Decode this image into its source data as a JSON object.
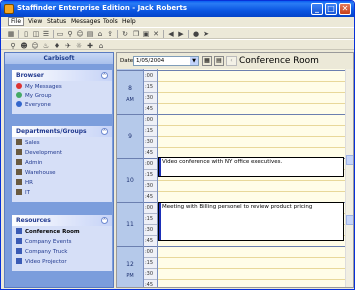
{
  "window": {
    "title": "Staffinder Enterprise Edition - Jack Roberts",
    "minimize": "_",
    "maximize": "□",
    "close": "✕"
  },
  "menu": [
    "File",
    "View",
    "Status",
    "Messages",
    "Tools",
    "Help"
  ],
  "sidebar": {
    "title": "Carbisoft",
    "browser": {
      "title": "Browser",
      "items": [
        "My Messages",
        "My Group",
        "Everyone"
      ]
    },
    "departments": {
      "title": "Departments/Groups",
      "items": [
        "Sales",
        "Development",
        "Admin",
        "Warehouse",
        "HR",
        "IT"
      ]
    },
    "resources": {
      "title": "Resources",
      "items": [
        "Conference Room",
        "Company Events",
        "Company Truck",
        "Video Projector"
      ]
    }
  },
  "main": {
    "date_label": "Date:",
    "date_value": "1/05/2004",
    "resource_title": "Conference Room",
    "hours": [
      {
        "hour": "8",
        "period": "AM"
      },
      {
        "hour": "9",
        "period": ""
      },
      {
        "hour": "10",
        "period": ""
      },
      {
        "hour": "11",
        "period": ""
      },
      {
        "hour": "12",
        "period": "PM"
      }
    ],
    "minutes": [
      ":00",
      ":15",
      ":30",
      ":45"
    ],
    "appointments": [
      {
        "text": "Video conference with NY office executives."
      },
      {
        "text": "Meeting with Billing personel to review product pricing"
      }
    ]
  },
  "colors": {
    "titlebar": "#0b56e2",
    "sidebar": "#7b9ddc",
    "slot_bg": "#fffde8",
    "appt_bar": "#1b2fb8"
  }
}
